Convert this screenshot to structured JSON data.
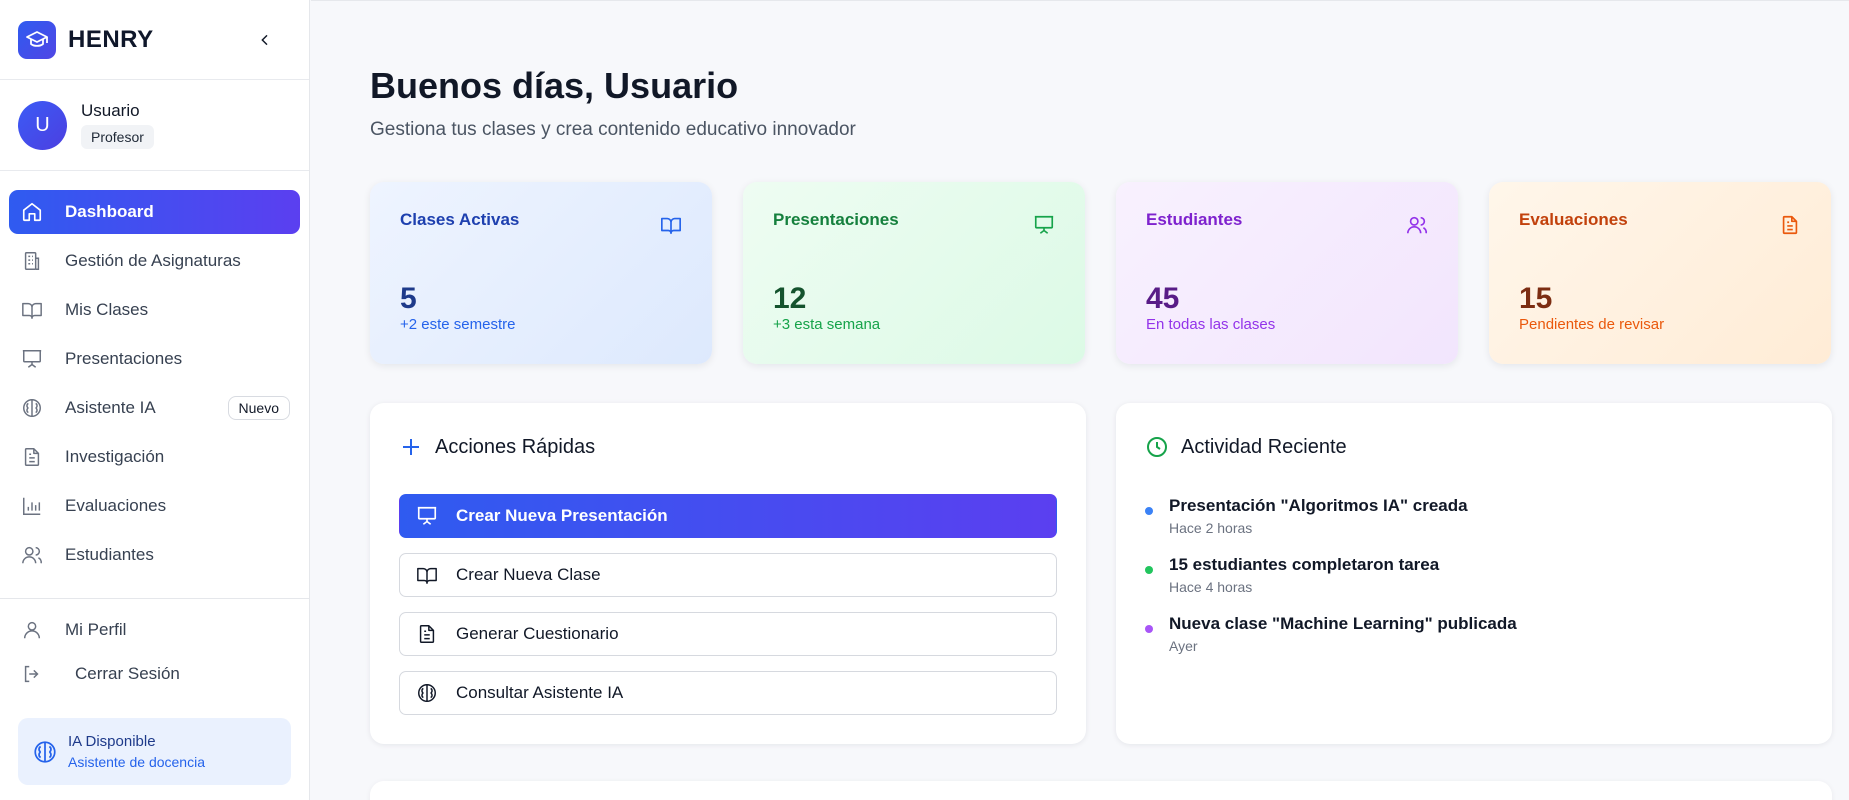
{
  "brand": {
    "name": "HENRY",
    "logo_icon": "graduation-cap-icon"
  },
  "user": {
    "initial": "U",
    "name": "Usuario",
    "role": "Profesor"
  },
  "sidebar": {
    "items": [
      {
        "label": "Dashboard",
        "icon": "home-icon",
        "active": true
      },
      {
        "label": "Gestión de Asignaturas",
        "icon": "building-icon"
      },
      {
        "label": "Mis Clases",
        "icon": "book-open-icon"
      },
      {
        "label": "Presentaciones",
        "icon": "presentation-icon"
      },
      {
        "label": "Asistente IA",
        "icon": "brain-icon",
        "badge": "Nuevo"
      },
      {
        "label": "Investigación",
        "icon": "document-icon"
      },
      {
        "label": "Evaluaciones",
        "icon": "bar-chart-icon"
      },
      {
        "label": "Estudiantes",
        "icon": "users-icon"
      }
    ],
    "bottom": [
      {
        "label": "Mi Perfil",
        "icon": "user-icon"
      },
      {
        "label": "Cerrar Sesión",
        "icon": "logout-icon"
      }
    ],
    "ai_card": {
      "title": "IA Disponible",
      "subtitle": "Asistente de docencia"
    }
  },
  "main": {
    "greeting": "Buenos días, Usuario",
    "subtitle": "Gestiona tus clases y crea contenido educativo innovador",
    "stats": [
      {
        "title": "Clases Activas",
        "value": "5",
        "sub": "+2 este semestre",
        "icon": "book-open-icon"
      },
      {
        "title": "Presentaciones",
        "value": "12",
        "sub": "+3 esta semana",
        "icon": "presentation-icon"
      },
      {
        "title": "Estudiantes",
        "value": "45",
        "sub": "En todas las clases",
        "icon": "users-icon"
      },
      {
        "title": "Evaluaciones",
        "value": "15",
        "sub": "Pendientes de revisar",
        "icon": "document-icon"
      }
    ],
    "quick_actions": {
      "title": "Acciones Rápidas",
      "items": [
        {
          "label": "Crear Nueva Presentación",
          "icon": "presentation-icon"
        },
        {
          "label": "Crear Nueva Clase",
          "icon": "book-open-icon"
        },
        {
          "label": "Generar Cuestionario",
          "icon": "document-icon"
        },
        {
          "label": "Consultar Asistente IA",
          "icon": "brain-icon"
        }
      ]
    },
    "activity": {
      "title": "Actividad Reciente",
      "items": [
        {
          "title": "Presentación \"Algoritmos IA\" creada",
          "time": "Hace 2 horas",
          "color": "#3b82f6"
        },
        {
          "title": "15 estudiantes completaron tarea",
          "time": "Hace 4 horas",
          "color": "#22c55e"
        },
        {
          "title": "Nueva clase \"Machine Learning\" publicada",
          "time": "Ayer",
          "color": "#a855f7"
        }
      ]
    }
  },
  "colors": {
    "accent_start": "#2f5bf0",
    "accent_end": "#5b3ff0"
  }
}
